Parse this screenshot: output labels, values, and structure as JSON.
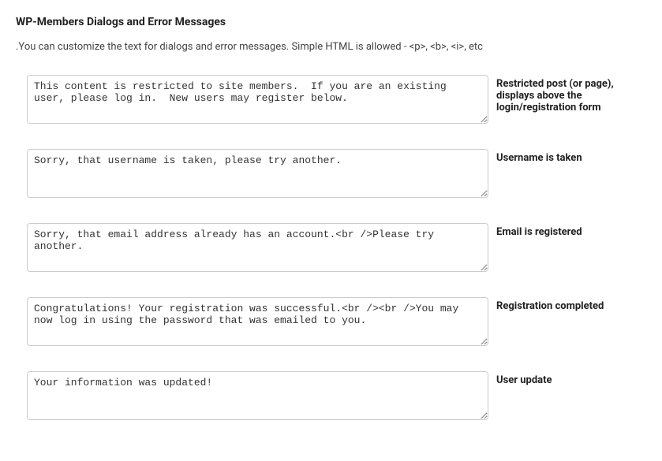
{
  "heading": "WP-Members Dialogs and Error Messages",
  "description": ".You can customize the text for dialogs and error messages. Simple HTML is allowed - <p>, <b>, <i>, etc",
  "rows": [
    {
      "label": "Restricted post (or page), displays above the login/registration form",
      "value": "This content is restricted to site members.  If you are an existing user, please log in.  New users may register below."
    },
    {
      "label": "Username is taken",
      "value": "Sorry, that username is taken, please try another."
    },
    {
      "label": "Email is registered",
      "value": "Sorry, that email address already has an account.<br />Please try another."
    },
    {
      "label": "Registration completed",
      "value": "Congratulations! Your registration was successful.<br /><br />You may now log in using the password that was emailed to you."
    },
    {
      "label": "User update",
      "value": "Your information was updated!"
    }
  ]
}
